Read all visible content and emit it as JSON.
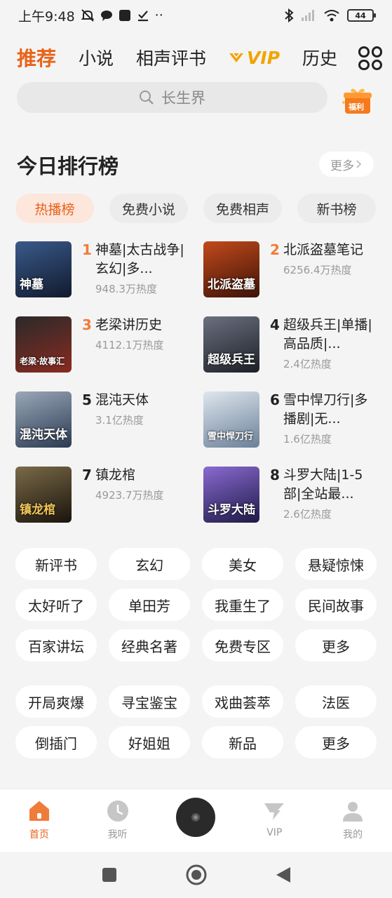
{
  "status_bar": {
    "time": "上午9:48",
    "battery": "44",
    "dots": "··"
  },
  "top_tabs": [
    {
      "label": "推荐",
      "active": true
    },
    {
      "label": "小说",
      "active": false
    },
    {
      "label": "相声评书",
      "active": false
    },
    {
      "label": "VIP",
      "active": false
    },
    {
      "label": "历史",
      "active": false
    }
  ],
  "search": {
    "placeholder": "长生界"
  },
  "gift": {
    "label": "福利"
  },
  "ranking": {
    "title": "今日排行榜",
    "more": "更多",
    "chips": [
      {
        "label": "热播榜",
        "active": true
      },
      {
        "label": "免费小说",
        "active": false
      },
      {
        "label": "免费相声",
        "active": false
      },
      {
        "label": "新书榜",
        "active": false
      }
    ],
    "items": [
      {
        "rank": "1",
        "name": "神墓|太古战争|玄幻|多...",
        "heat": "948.3万热度",
        "cover_text": "神墓",
        "cover_color": "#1d2c4a"
      },
      {
        "rank": "2",
        "name": "北派盗墓笔记",
        "heat": "6256.4万热度",
        "cover_text": "北派盗墓",
        "cover_color": "#7a2a10"
      },
      {
        "rank": "3",
        "name": "老梁讲历史",
        "heat": "4112.1万热度",
        "cover_text": "老梁·故事汇",
        "cover_color": "#5a1f1a"
      },
      {
        "rank": "4",
        "name": "超级兵王|单播|高品质|...",
        "heat": "2.4亿热度",
        "cover_text": "超级兵王",
        "cover_color": "#3a3e4a"
      },
      {
        "rank": "5",
        "name": "混沌天体",
        "heat": "3.1亿热度",
        "cover_text": "混沌天体",
        "cover_color": "#4a5a6e"
      },
      {
        "rank": "6",
        "name": "雪中悍刀行|多播剧|无...",
        "heat": "1.6亿热度",
        "cover_text": "雪中悍刀行",
        "cover_color": "#7f95ad"
      },
      {
        "rank": "7",
        "name": "镇龙棺",
        "heat": "4923.7万热度",
        "cover_text": "镇龙棺",
        "cover_color": "#3b3023"
      },
      {
        "rank": "8",
        "name": "斗罗大陆|1-5部|全站最...",
        "heat": "2.6亿热度",
        "cover_text": "斗罗大陆",
        "cover_color": "#3a3470"
      }
    ]
  },
  "tags_group1": [
    "新评书",
    "玄幻",
    "美女",
    "悬疑惊悚",
    "太好听了",
    "单田芳",
    "我重生了",
    "民间故事",
    "百家讲坛",
    "经典名著",
    "免费专区",
    "更多"
  ],
  "tags_group2": [
    "开局爽爆",
    "寻宝鉴宝",
    "戏曲荟萃",
    "法医",
    "倒插门",
    "好姐姐",
    "新品",
    "更多"
  ],
  "bottom_nav": [
    {
      "label": "首页",
      "icon": "home-icon",
      "active": true
    },
    {
      "label": "我听",
      "icon": "clock-icon",
      "active": false
    },
    {
      "label": "",
      "icon": "disc-icon",
      "active": false
    },
    {
      "label": "VIP",
      "icon": "vip-icon",
      "active": false
    },
    {
      "label": "我的",
      "icon": "profile-icon",
      "active": false
    }
  ],
  "colors": {
    "accent": "#e8631a",
    "vip": "#f2a400",
    "background": "#f4f4f4"
  }
}
